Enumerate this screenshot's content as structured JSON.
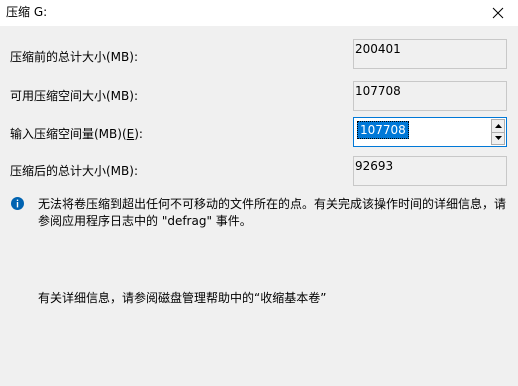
{
  "window": {
    "title": "压缩 G:"
  },
  "fields": {
    "total_before": {
      "label": "压缩前的总计大小(MB):",
      "value": "200401"
    },
    "available": {
      "label": "可用压缩空间大小(MB):",
      "value": "107708"
    },
    "amount": {
      "label_prefix": "输入压缩空间量(MB)(",
      "label_key": "E",
      "label_suffix": "):",
      "value": "107708"
    },
    "total_after": {
      "label": "压缩后的总计大小(MB):",
      "value": "92693"
    }
  },
  "info": {
    "line1": "无法将卷压缩到超出任何不可移动的文件所在的点。有关完成该操作时间的详细信息，请",
    "line2": "参阅应用程序日志中的 \"defrag\" 事件。",
    "more": "有关详细信息，请参阅磁盘管理帮助中的“收缩基本卷”"
  },
  "colors": {
    "accent": "#0078d7",
    "info_icon": "#0063b1"
  }
}
